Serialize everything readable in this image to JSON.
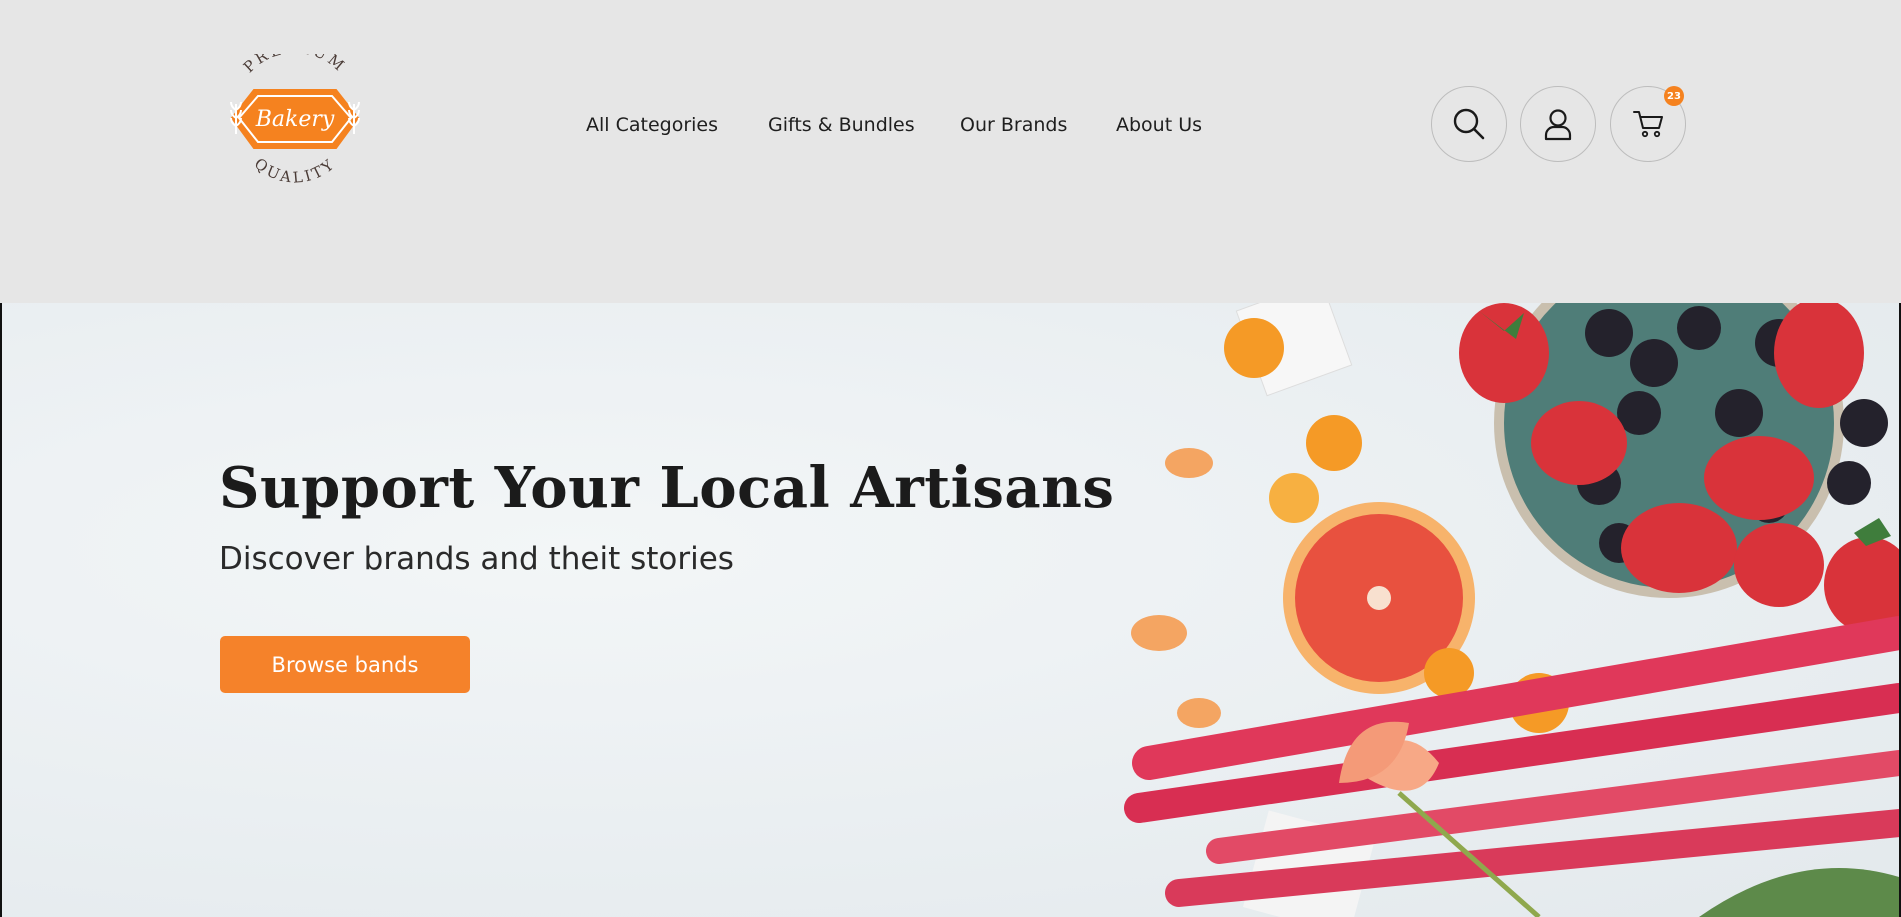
{
  "logo": {
    "top_text": "PREMIUM",
    "center_text": "Bakery",
    "bottom_text": "QUALITY",
    "color": "#f5821f"
  },
  "nav": {
    "items": [
      {
        "label": "All Categories"
      },
      {
        "label": "Gifts & Bundles"
      },
      {
        "label": "Our Brands"
      },
      {
        "label": "About Us"
      }
    ]
  },
  "header_icons": {
    "search": "search-icon",
    "account": "user-icon",
    "cart": "cart-icon",
    "cart_count": "23"
  },
  "hero": {
    "title": "Support Your Local Artisans",
    "subtitle": "Discover brands and theit stories",
    "cta_label": "Browse bands",
    "accent": "#f5822a"
  }
}
